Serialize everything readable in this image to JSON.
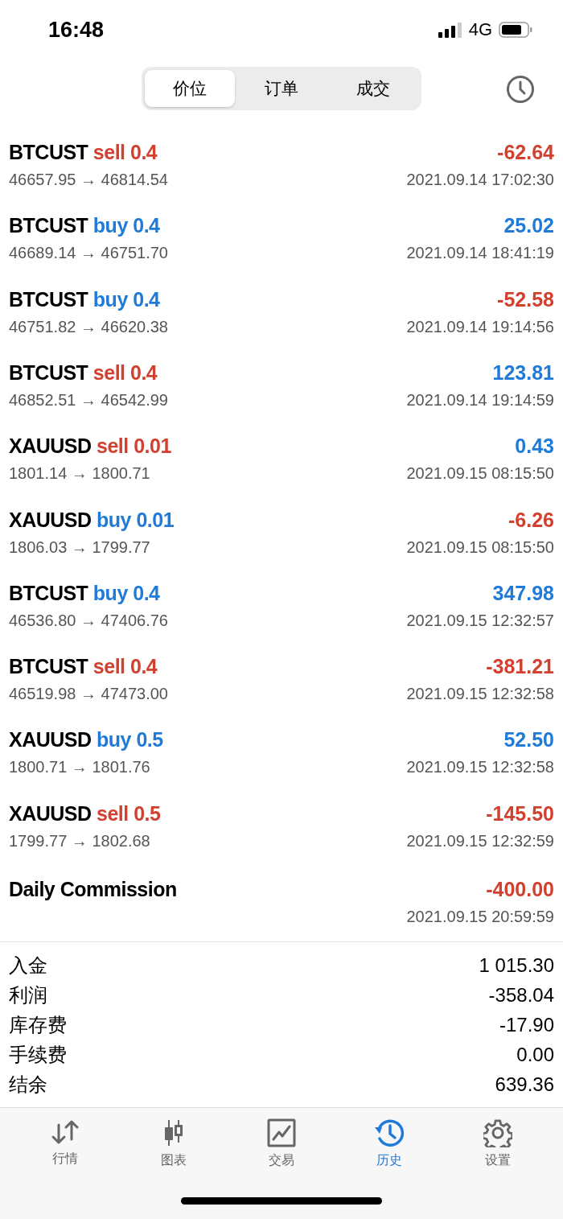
{
  "status_bar": {
    "time": "16:48",
    "network": "4G"
  },
  "segments": [
    {
      "label": "价位",
      "selected": true
    },
    {
      "label": "订单",
      "selected": false
    },
    {
      "label": "成交",
      "selected": false
    }
  ],
  "deals": [
    {
      "kind": "trade",
      "symbol": "BTCUST",
      "side": "sell",
      "volume": "0.4",
      "prices": "46657.95 → 46814.54",
      "profit": "-62.64",
      "loss": true,
      "time": "2021.09.14 17:02:30"
    },
    {
      "kind": "trade",
      "symbol": "BTCUST",
      "side": "buy",
      "volume": "0.4",
      "prices": "46689.14 → 46751.70",
      "profit": "25.02",
      "loss": false,
      "time": "2021.09.14 18:41:19"
    },
    {
      "kind": "trade",
      "symbol": "BTCUST",
      "side": "buy",
      "volume": "0.4",
      "prices": "46751.82 → 46620.38",
      "profit": "-52.58",
      "loss": true,
      "time": "2021.09.14 19:14:56"
    },
    {
      "kind": "trade",
      "symbol": "BTCUST",
      "side": "sell",
      "volume": "0.4",
      "prices": "46852.51 → 46542.99",
      "profit": "123.81",
      "loss": false,
      "time": "2021.09.14 19:14:59"
    },
    {
      "kind": "trade",
      "symbol": "XAUUSD",
      "side": "sell",
      "volume": "0.01",
      "prices": "1801.14 → 1800.71",
      "profit": "0.43",
      "loss": false,
      "time": "2021.09.15 08:15:50"
    },
    {
      "kind": "trade",
      "symbol": "XAUUSD",
      "side": "buy",
      "volume": "0.01",
      "prices": "1806.03 → 1799.77",
      "profit": "-6.26",
      "loss": true,
      "time": "2021.09.15 08:15:50"
    },
    {
      "kind": "trade",
      "symbol": "BTCUST",
      "side": "buy",
      "volume": "0.4",
      "prices": "46536.80 → 47406.76",
      "profit": "347.98",
      "loss": false,
      "time": "2021.09.15 12:32:57"
    },
    {
      "kind": "trade",
      "symbol": "BTCUST",
      "side": "sell",
      "volume": "0.4",
      "prices": "46519.98 → 47473.00",
      "profit": "-381.21",
      "loss": true,
      "time": "2021.09.15 12:32:58"
    },
    {
      "kind": "trade",
      "symbol": "XAUUSD",
      "side": "buy",
      "volume": "0.5",
      "prices": "1800.71 → 1801.76",
      "profit": "52.50",
      "loss": false,
      "time": "2021.09.15 12:32:58"
    },
    {
      "kind": "trade",
      "symbol": "XAUUSD",
      "side": "sell",
      "volume": "0.5",
      "prices": "1799.77 → 1802.68",
      "profit": "-145.50",
      "loss": true,
      "time": "2021.09.15 12:32:59"
    },
    {
      "kind": "balance",
      "symbol": "Daily Commission",
      "profit": "-400.00",
      "loss": true,
      "time": "2021.09.15 20:59:59"
    }
  ],
  "summary": [
    {
      "label": "入金",
      "value": "1 015.30"
    },
    {
      "label": "利润",
      "value": "-358.04"
    },
    {
      "label": "库存费",
      "value": "-17.90"
    },
    {
      "label": "手续费",
      "value": "0.00"
    },
    {
      "label": "结余",
      "value": "639.36"
    }
  ],
  "tab_bar": [
    {
      "kind": "quotes",
      "label": "行情",
      "selected": false
    },
    {
      "kind": "chart",
      "label": "图表",
      "selected": false
    },
    {
      "kind": "trade",
      "label": "交易",
      "selected": false
    },
    {
      "kind": "history",
      "label": "历史",
      "selected": true
    },
    {
      "kind": "settings",
      "label": "设置",
      "selected": false
    }
  ]
}
